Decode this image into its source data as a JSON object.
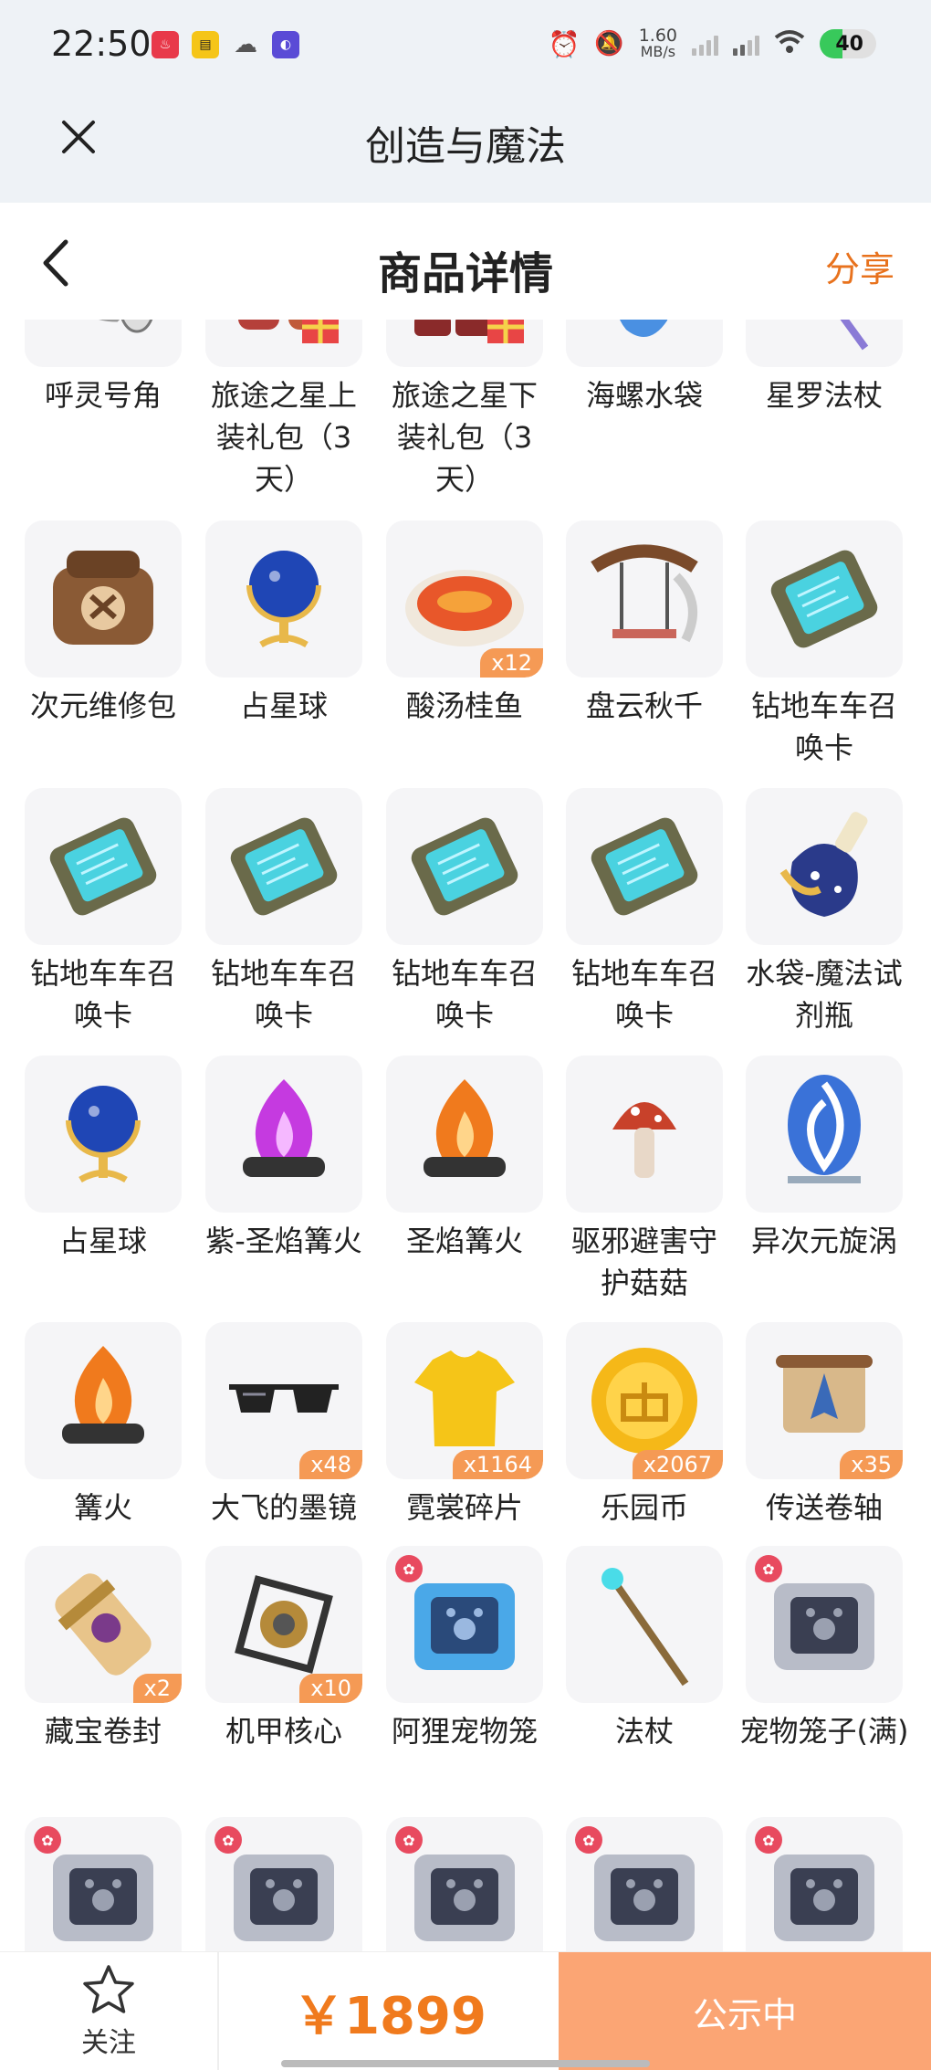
{
  "status_bar": {
    "time": "22:50",
    "speed_value": "1.60",
    "speed_unit": "MB/s",
    "battery": "40",
    "battery_level": 0.4
  },
  "app_header": {
    "title": "创造与魔法"
  },
  "page_header": {
    "title": "商品详情",
    "share_label": "分享"
  },
  "items": [
    {
      "label": "呼灵号角",
      "qty": "",
      "icon": "horn"
    },
    {
      "label": "旅途之星上装礼包（3天）",
      "qty": "",
      "icon": "outfit-top"
    },
    {
      "label": "旅途之星下装礼包（3天）",
      "qty": "",
      "icon": "outfit-bottom"
    },
    {
      "label": "海螺水袋",
      "qty": "",
      "icon": "conch"
    },
    {
      "label": "星罗法杖",
      "qty": "",
      "icon": "star-staff"
    },
    {
      "label": "次元维修包",
      "qty": "",
      "icon": "repair-bag"
    },
    {
      "label": "占星球",
      "qty": "",
      "icon": "globe"
    },
    {
      "label": "酸汤桂鱼",
      "qty": "x12",
      "icon": "fish-dish"
    },
    {
      "label": "盘云秋千",
      "qty": "",
      "icon": "swing"
    },
    {
      "label": "钻地车车召唤卡",
      "qty": "",
      "icon": "summon-card"
    },
    {
      "label": "钻地车车召唤卡",
      "qty": "",
      "icon": "summon-card"
    },
    {
      "label": "钻地车车召唤卡",
      "qty": "",
      "icon": "summon-card"
    },
    {
      "label": "钻地车车召唤卡",
      "qty": "",
      "icon": "summon-card"
    },
    {
      "label": "钻地车车召唤卡",
      "qty": "",
      "icon": "summon-card"
    },
    {
      "label": "水袋-魔法试剂瓶",
      "qty": "",
      "icon": "potion"
    },
    {
      "label": "占星球",
      "qty": "",
      "icon": "globe"
    },
    {
      "label": "紫-圣焰篝火",
      "qty": "",
      "icon": "purple-fire"
    },
    {
      "label": "圣焰篝火",
      "qty": "",
      "icon": "campfire"
    },
    {
      "label": "驱邪避害守护菇菇",
      "qty": "",
      "icon": "mushroom"
    },
    {
      "label": "异次元旋涡",
      "qty": "",
      "icon": "vortex"
    },
    {
      "label": "篝火",
      "qty": "",
      "icon": "campfire"
    },
    {
      "label": "大飞的墨镜",
      "qty": "x48",
      "icon": "sunglasses"
    },
    {
      "label": "霓裳碎片",
      "qty": "x1164",
      "icon": "shirt"
    },
    {
      "label": "乐园币",
      "qty": "x2067",
      "icon": "coin"
    },
    {
      "label": "传送卷轴",
      "qty": "x35",
      "icon": "scroll"
    },
    {
      "label": "藏宝卷封",
      "qty": "x2",
      "icon": "treasure-scroll"
    },
    {
      "label": "机甲核心",
      "qty": "x10",
      "icon": "mech-core"
    },
    {
      "label": "阿狸宠物笼",
      "qty": "",
      "icon": "pet-cage-blue"
    },
    {
      "label": "法杖",
      "qty": "",
      "icon": "staff"
    },
    {
      "label": "宠物笼子(满)",
      "qty": "",
      "icon": "pet-cage-grey"
    },
    {
      "label": "",
      "qty": "",
      "icon": "pet-cage-grey"
    },
    {
      "label": "",
      "qty": "",
      "icon": "pet-cage-grey"
    },
    {
      "label": "",
      "qty": "",
      "icon": "pet-cage-grey"
    },
    {
      "label": "",
      "qty": "",
      "icon": "pet-cage-grey"
    },
    {
      "label": "",
      "qty": "",
      "icon": "pet-cage-grey"
    }
  ],
  "bottom_bar": {
    "follow_label": "关注",
    "price": "￥1899",
    "status_label": "公示中"
  },
  "colors": {
    "accent": "#e8721d",
    "qty_badge": "#f59a55",
    "status_button": "#fba574"
  }
}
